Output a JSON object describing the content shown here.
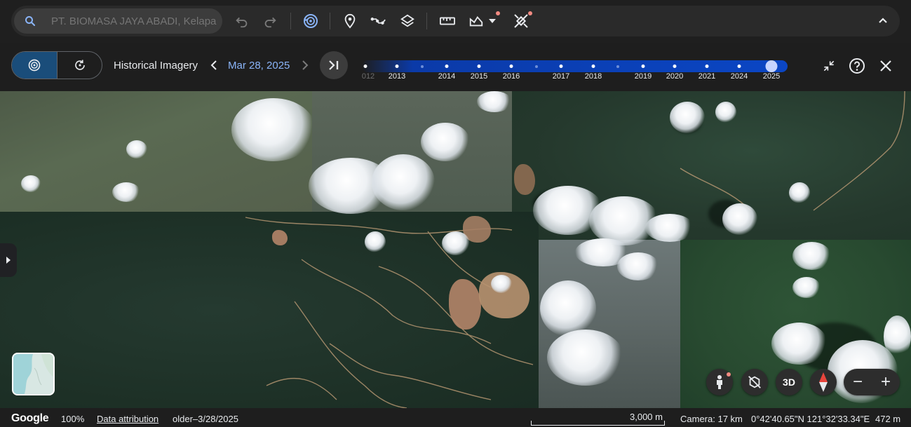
{
  "toolbar": {
    "search_placeholder": "PT. BIOMASA JAYA ABADI, Kelapa",
    "icons": [
      "search-icon",
      "undo-icon",
      "redo-icon",
      "historical-imagery-icon",
      "place-marker-icon",
      "path-icon",
      "layers-icon",
      "measure-icon",
      "elevation-profile-icon",
      "dropdown-icon",
      "satellite-tools-icon",
      "collapse-icon"
    ],
    "accent_color": "#8ab4f8",
    "notification_color": "#f28b82"
  },
  "history": {
    "label": "Historical Imagery",
    "date": "Mar 28, 2025",
    "timeline": {
      "ticks": [
        {
          "label": "2012",
          "shown": "012",
          "major": true,
          "faded": true
        },
        {
          "label": "2013",
          "shown": "2013",
          "major": true
        },
        {
          "label": "",
          "shown": "",
          "major": false
        },
        {
          "label": "2014",
          "shown": "2014",
          "major": true
        },
        {
          "label": "2015",
          "shown": "2015",
          "major": true
        },
        {
          "label": "2016",
          "shown": "2016",
          "major": true
        },
        {
          "label": "",
          "shown": "",
          "major": false
        },
        {
          "label": "2017",
          "shown": "2017",
          "major": true
        },
        {
          "label": "2018",
          "shown": "2018",
          "major": true
        },
        {
          "label": "",
          "shown": "",
          "major": false
        },
        {
          "label": "2019",
          "shown": "2019",
          "major": true
        },
        {
          "label": "2020",
          "shown": "2020",
          "major": true
        },
        {
          "label": "2021",
          "shown": "2021",
          "major": true
        },
        {
          "label": "2024",
          "shown": "2024",
          "major": true
        },
        {
          "label": "2025",
          "shown": "2025",
          "major": true,
          "selected": true
        }
      ]
    }
  },
  "map_controls": {
    "three_d_label": "3D",
    "zoom_out": "−",
    "zoom_in": "+"
  },
  "status": {
    "logo": "Google",
    "zoom": "100%",
    "attribution": "Data attribution",
    "imagery_date": "older–3/28/2025",
    "scale_label": "3,000 m",
    "camera": "Camera: 17 km",
    "coordinates": "0°42'40.65\"N 121°32'33.34\"E",
    "elevation": "472 m"
  }
}
